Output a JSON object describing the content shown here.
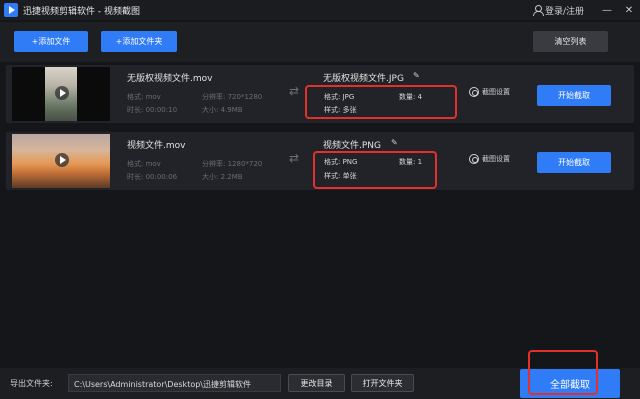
{
  "app": {
    "title": "迅捷视频剪辑软件 - 视频截图",
    "login": "登录/注册",
    "min": "—",
    "close": "✕"
  },
  "toolbar": {
    "add_file": "+添加文件",
    "add_folder": "+添加文件夹",
    "clear": "清空列表"
  },
  "rows": [
    {
      "filename": "无版权视频文件.mov",
      "format_label": "格式: mov",
      "resolution_label": "分辨率: 720*1280",
      "duration_label": "时长: 00:00:10",
      "size_label": "大小: 4.9MB",
      "output_name": "无版权视频文件.JPG",
      "out_format": "格式: JPG",
      "out_count": "数量: 4",
      "out_style": "样式: 多张",
      "settings": "截图设置",
      "start": "开始截取"
    },
    {
      "filename": "视频文件.mov",
      "format_label": "格式: mov",
      "resolution_label": "分辨率: 1280*720",
      "duration_label": "时长: 00:00:06",
      "size_label": "大小: 2.2MB",
      "output_name": "视频文件.PNG",
      "out_format": "格式: PNG",
      "out_count": "数量: 1",
      "out_style": "样式: 单张",
      "settings": "截图设置",
      "start": "开始截取"
    }
  ],
  "footer": {
    "export_label": "导出文件夹:",
    "path": "C:\\Users\\Administrator\\Desktop\\迅捷剪辑软件",
    "change_dir": "更改目录",
    "open_folder": "打开文件夹",
    "capture_all": "全部截取"
  },
  "colors": {
    "accent": "#2f7cf6",
    "highlight": "#e1312a"
  },
  "icons": {
    "logo": "app-logo-icon",
    "user": "user-icon",
    "edit": "edit-icon",
    "swap": "swap-arrows-icon",
    "settings": "gear-icon",
    "play": "play-icon"
  }
}
